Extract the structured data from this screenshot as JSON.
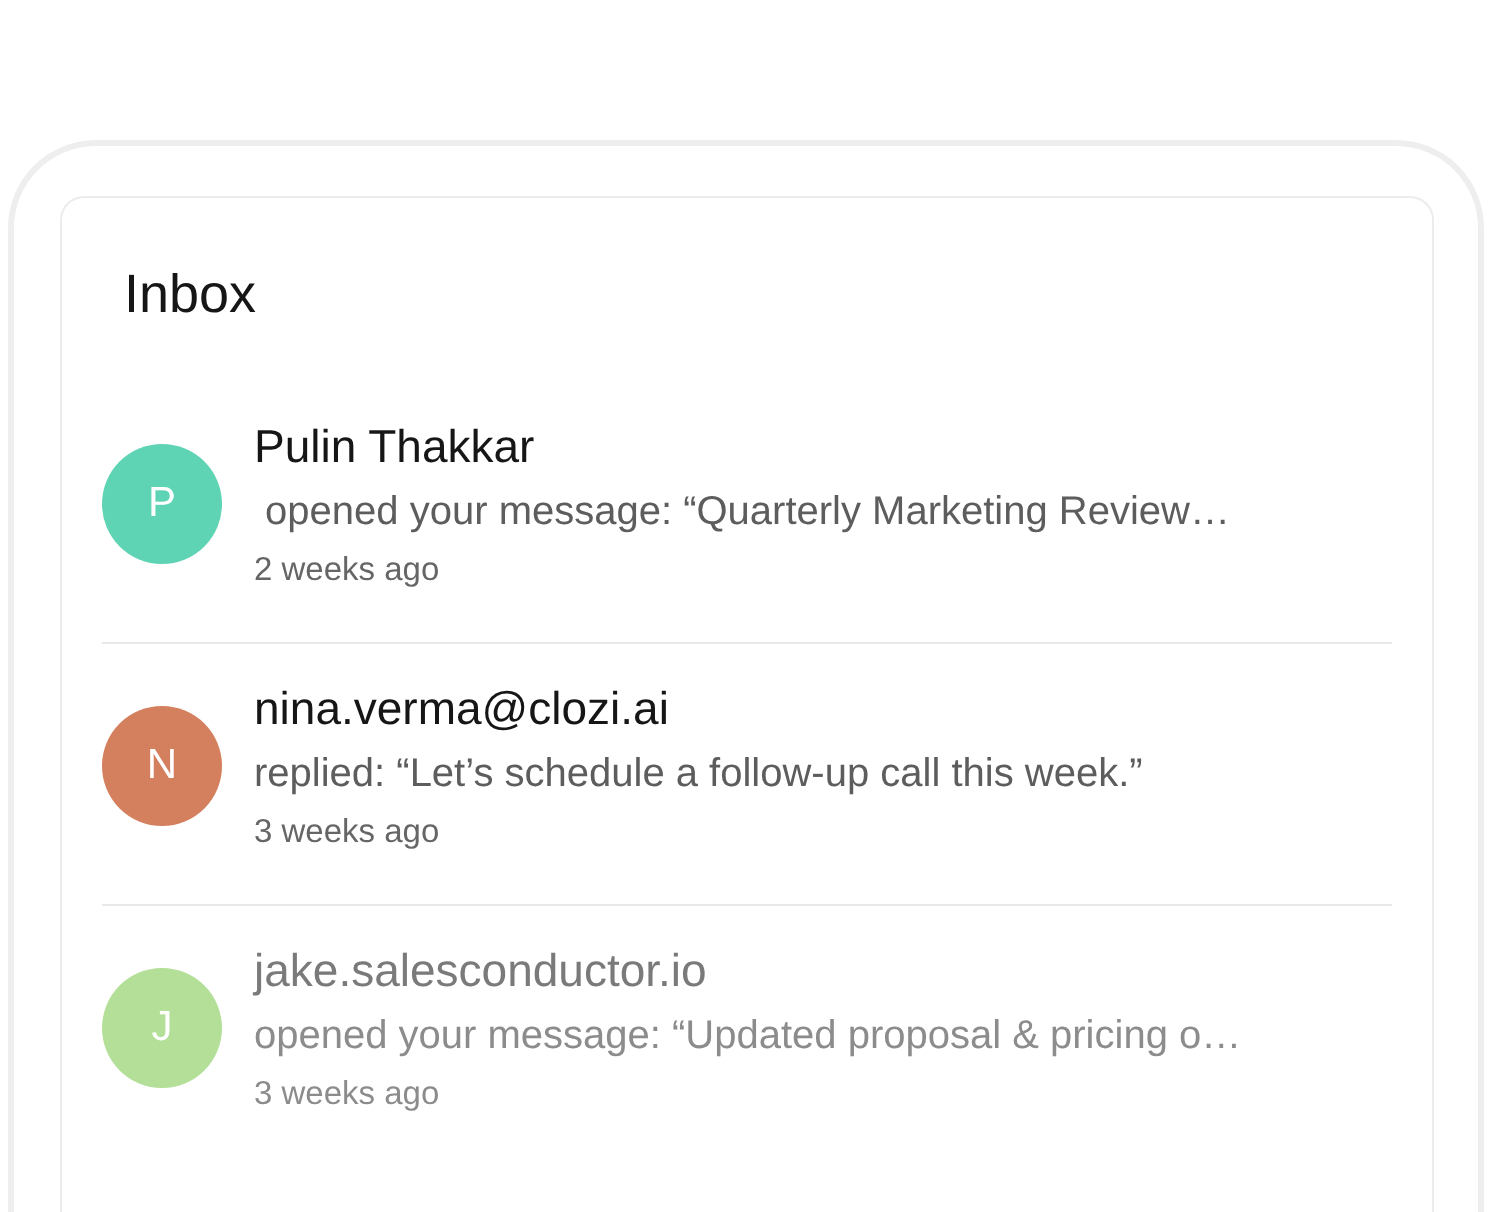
{
  "title": "Inbox",
  "messages": [
    {
      "initial": "P",
      "color": "#5fd4b4",
      "sender": "Pulin Thakkar",
      "text": " opened your message: “Quarterly Marketing Review…",
      "time": "2 weeks ago",
      "dimmed": false
    },
    {
      "initial": "N",
      "color": "#d4805e",
      "sender": "nina.verma@clozi.ai",
      "text": "replied: “Let’s schedule a follow-up call this week.”",
      "time": "3 weeks ago",
      "dimmed": false
    },
    {
      "initial": "J",
      "color": "#b4df98",
      "sender": "jake.salesconductor.io",
      "text": "opened your message: “Updated proposal & pricing o…",
      "time": "3 weeks ago",
      "dimmed": true
    }
  ]
}
